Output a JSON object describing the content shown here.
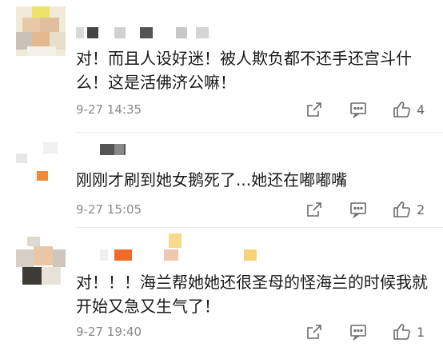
{
  "comments": [
    {
      "text": "对！而且人设好迷！被人欺负都不还手还宫斗什么！这是活佛济公嘛！",
      "time": "9-27 14:35",
      "likes": "4"
    },
    {
      "text": "刚刚才刷到她女鹅死了...她还在嘟嘟嘴",
      "time": "9-27 15:05",
      "likes": "2"
    },
    {
      "text": "对！！！海兰帮她她还很圣母的怪海兰的时候我就开始又急又生气了！",
      "time": "9-27 19:40",
      "likes": "1"
    }
  ],
  "icons": {
    "share": "share-icon",
    "comment": "comment-icon",
    "like": "thumbs-up-icon"
  },
  "colors": {
    "time": "#8a8a8a",
    "icon": "#6b6b6b",
    "text": "#1a1a1a"
  }
}
